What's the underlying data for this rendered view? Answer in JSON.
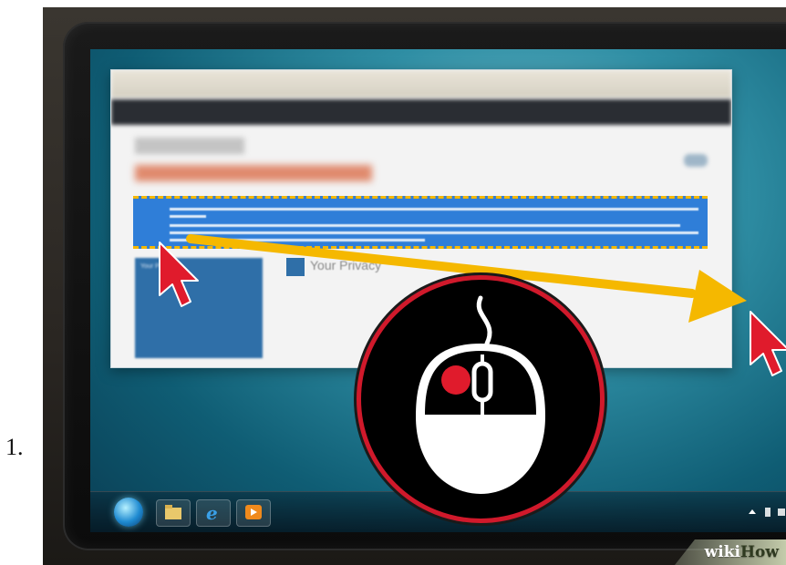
{
  "list": {
    "number": "1."
  },
  "browser": {
    "sidebar_label": "Your Privacy",
    "privacy_heading": "Your Privacy"
  },
  "watermark": {
    "prefix": "wiki",
    "suffix": "How"
  },
  "colors": {
    "selection": "#2f7ed8",
    "drag_arrow": "#f5b800",
    "cursor": "#e01b2c",
    "badge_ring": "#d0192b",
    "left_button": "#e01b2c"
  },
  "icons": [
    "mouse-cursor-icon",
    "drag-arrow-icon",
    "computer-mouse-icon",
    "start-orb-icon",
    "folder-icon",
    "internet-explorer-icon",
    "media-player-icon"
  ]
}
